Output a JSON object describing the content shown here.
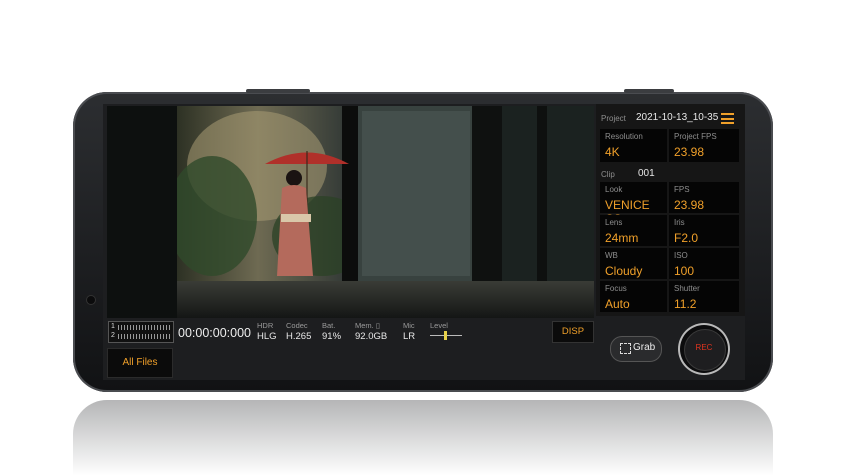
{
  "project": {
    "label": "Project",
    "value": "2021-10-13_10-35"
  },
  "resolution": {
    "label": "Resolution",
    "value": "4K"
  },
  "project_fps": {
    "label": "Project FPS",
    "value": "23.98"
  },
  "clip": {
    "label": "Clip",
    "value": "001"
  },
  "look": {
    "label": "Look",
    "value": "VENICE CS"
  },
  "fps": {
    "label": "FPS",
    "value": "23.98"
  },
  "lens": {
    "label": "Lens",
    "value": "24mm"
  },
  "iris": {
    "label": "Iris",
    "value": "F2.0"
  },
  "wb": {
    "label": "WB",
    "value": "Cloudy"
  },
  "iso": {
    "label": "ISO",
    "value": "100"
  },
  "focus": {
    "label": "Focus",
    "value": "Auto"
  },
  "shutter": {
    "label": "Shutter",
    "value": "11.2"
  },
  "audio_meter": {
    "ch1": "1",
    "ch2": "2"
  },
  "timecode": "00:00:00:000",
  "hdr": {
    "label": "HDR",
    "value": "HLG"
  },
  "codec": {
    "label": "Codec",
    "value": "H.265"
  },
  "battery": {
    "label": "Bat.",
    "value": "91%"
  },
  "memory": {
    "label": "Mem. ▯",
    "value": "92.0GB"
  },
  "mic": {
    "label": "Mic",
    "value": "LR"
  },
  "level": {
    "label": "Level"
  },
  "disp_label": "DISP",
  "all_files_label": "All Files",
  "grab_label": "Grab",
  "rec_label": "REC",
  "colors": {
    "accent": "#f0a02a",
    "rec": "#e0341f"
  }
}
